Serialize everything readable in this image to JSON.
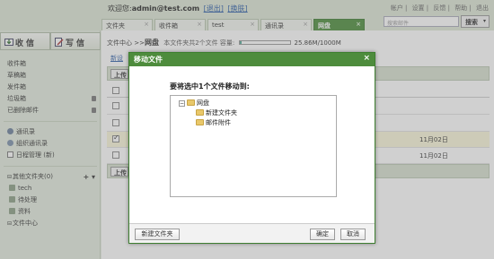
{
  "header": {
    "greeting_prefix": "欢迎您:",
    "user": "admin@test.com",
    "exit_label": "[退出]",
    "switch_label": "[换肤]",
    "top_links": [
      "帐户",
      "设置",
      "反馈",
      "帮助",
      "退出"
    ],
    "tabs": [
      {
        "label": "文件夹",
        "close": "×"
      },
      {
        "label": "收件箱",
        "close": "×"
      },
      {
        "label": "test",
        "close": "×"
      },
      {
        "label": "通讯录",
        "close": "×"
      },
      {
        "label": "网盘",
        "close": "×",
        "active": true
      }
    ],
    "search_placeholder": "搜索邮件",
    "search_button": "搜索"
  },
  "sidebar": {
    "receive_label": "收信",
    "write_label": "写信",
    "mail_items": [
      "收件箱",
      "草稿箱",
      "发件箱",
      "垃圾箱",
      "已删除邮件"
    ],
    "tool_items": [
      "通讯录",
      "组织通讯录",
      "日程管理 (新)"
    ],
    "other_folders": "其他文件夹(0)",
    "other_actions": "+ ▾",
    "folders": [
      "tech",
      "待处理",
      "资料"
    ],
    "file_center": "文件中心"
  },
  "main": {
    "breadcrumb_root": "文件中心",
    "breadcrumb_sep": " >>",
    "breadcrumb_current": "网盘",
    "summary": "本文件夹共2个文件 容量:",
    "quota_text": "25.86M/1000M",
    "quota_fraction": 0.026,
    "link_text": "新设",
    "toolbar_upload": "上传",
    "dates": [
      "11月02日",
      "11月02日"
    ]
  },
  "dialog": {
    "title": "移动文件",
    "close": "×",
    "prompt": "要将选中1个文件移动到:",
    "tree_root": "网盘",
    "tree_children": [
      "新建文件夹",
      "邮件附件"
    ],
    "new_folder_button": "新建文件夹",
    "ok_button": "确定",
    "cancel_button": "取消"
  }
}
